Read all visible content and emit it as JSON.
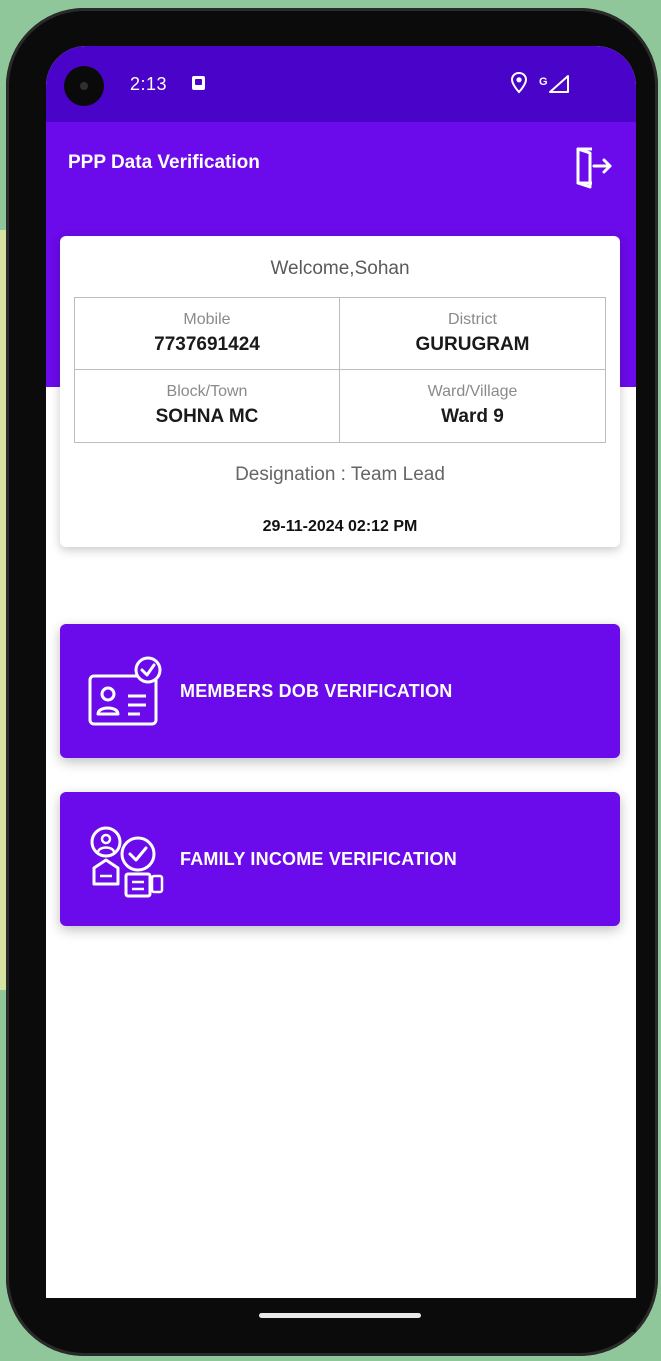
{
  "status_bar": {
    "time": "2:13",
    "network": "G"
  },
  "header": {
    "title": "PPP Data Verification"
  },
  "profile": {
    "welcome": "Welcome,Sohan",
    "mobile_label": "Mobile",
    "mobile_value": "7737691424",
    "district_label": "District",
    "district_value": "GURUGRAM",
    "block_label": "Block/Town",
    "block_value": "SOHNA MC",
    "ward_label": "Ward/Village",
    "ward_value": "Ward 9",
    "designation": "Designation : Team Lead",
    "datetime": "29-11-2024 02:12 PM"
  },
  "actions": {
    "dob_label": "MEMBERS DOB VERIFICATION",
    "income_label": "FAMILY INCOME VERIFICATION"
  },
  "colors": {
    "status": "#4a03c9",
    "primary": "#6b0aea",
    "background": "#8fc79a"
  },
  "icons": {
    "logout": "logout-icon",
    "dob": "id-card-check-icon",
    "income": "income-verification-icon"
  }
}
